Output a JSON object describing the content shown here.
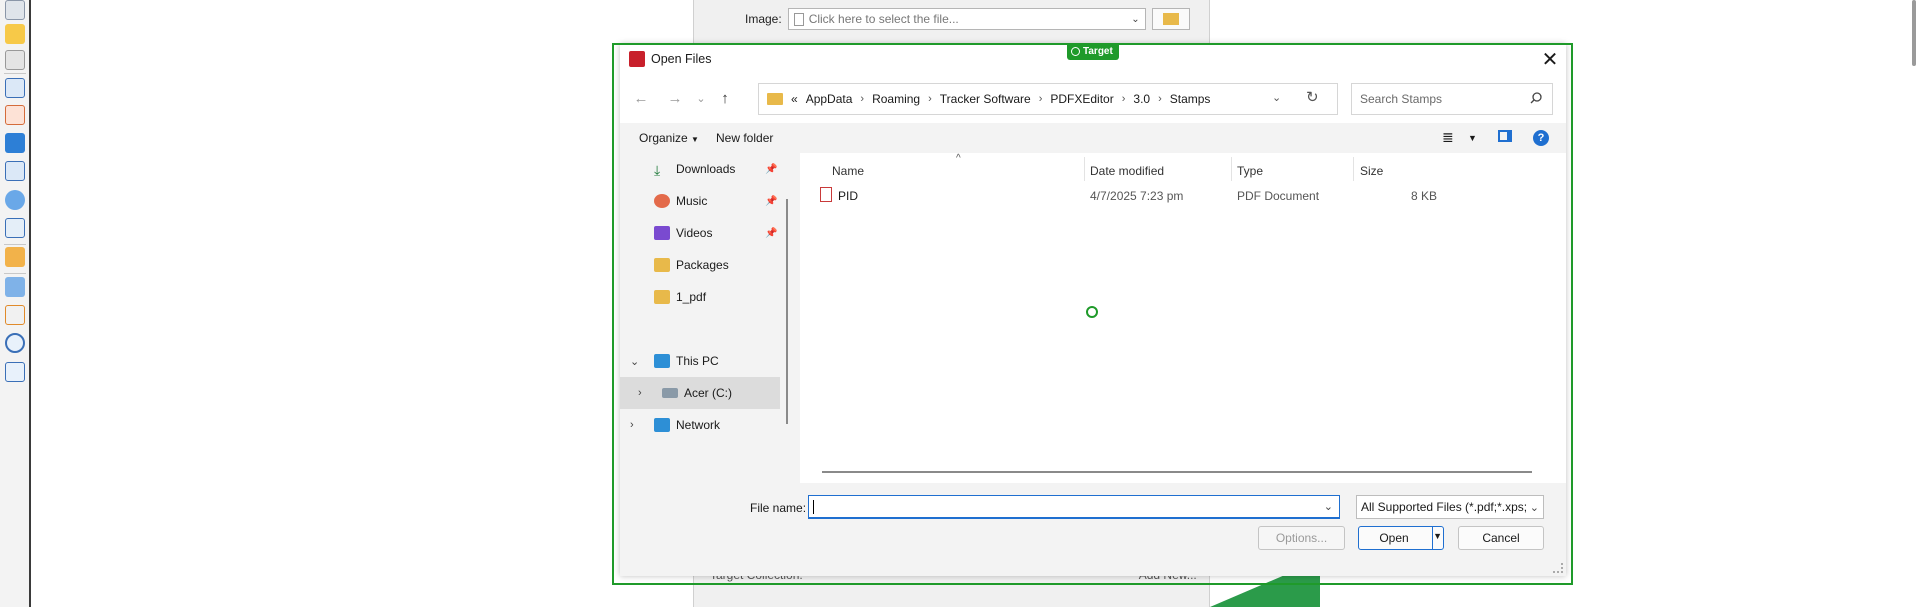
{
  "background_app": {
    "image_label": "Image:",
    "image_placeholder": "Click here to select the file...",
    "target_collection_label": "Target Collection:",
    "add_new_label": "Add New..."
  },
  "target_badge": "Target",
  "dialog": {
    "title": "Open Files",
    "breadcrumb": [
      "AppData",
      "Roaming",
      "Tracker Software",
      "PDFXEditor",
      "3.0",
      "Stamps"
    ],
    "breadcrumb_prefix": "«",
    "search_placeholder": "Search Stamps",
    "toolbar": {
      "organize": "Organize",
      "new_folder": "New folder"
    },
    "nav_items": [
      {
        "label": "Downloads",
        "icon": "download-icon",
        "pinned": true
      },
      {
        "label": "Music",
        "icon": "music-icon",
        "pinned": true
      },
      {
        "label": "Videos",
        "icon": "video-icon",
        "pinned": true
      },
      {
        "label": "Packages",
        "icon": "folder-icon",
        "pinned": false
      },
      {
        "label": "1_pdf",
        "icon": "folder-icon",
        "pinned": false
      },
      {
        "label": "This PC",
        "icon": "computer-icon",
        "expanded": true
      },
      {
        "label": "Acer (C:)",
        "icon": "drive-icon",
        "selected": true
      },
      {
        "label": "Network",
        "icon": "network-icon",
        "expanded": false
      }
    ],
    "columns": [
      "Name",
      "Date modified",
      "Type",
      "Size"
    ],
    "files": [
      {
        "name": "PID",
        "date": "4/7/2025 7:23 pm",
        "type": "PDF Document",
        "size": "8 KB"
      }
    ],
    "file_name_label": "File name:",
    "file_name_value": "",
    "file_type": "All Supported Files (*.pdf;*.xps;",
    "buttons": {
      "options": "Options...",
      "open": "Open",
      "cancel": "Cancel"
    }
  },
  "colors": {
    "accent": "#1f6fd0",
    "target_green": "#1f9a2a"
  }
}
